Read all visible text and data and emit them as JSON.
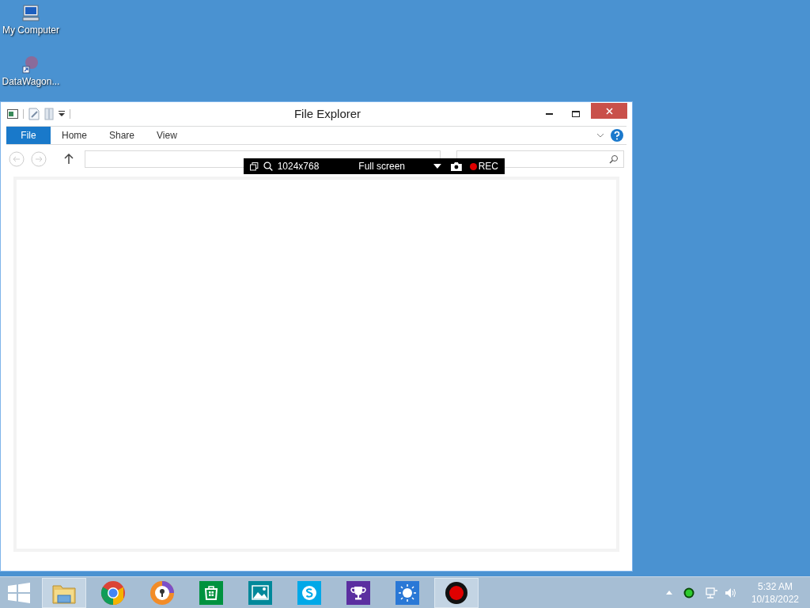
{
  "desktop_icons": [
    {
      "kind": "computer",
      "label": "My Computer"
    },
    {
      "kind": "shortcut",
      "label": "DataWagon..."
    }
  ],
  "window": {
    "title": "File Explorer",
    "ribbon_tabs": [
      {
        "label": "File",
        "selected": true
      },
      {
        "label": "Home",
        "selected": false
      },
      {
        "label": "Share",
        "selected": false
      },
      {
        "label": "View",
        "selected": false
      }
    ]
  },
  "recorder_bar": {
    "resolution": "1024x768",
    "mode": "Full screen",
    "record": "REC"
  },
  "taskbar": {
    "apps": [
      {
        "kind": "folder",
        "selected": true
      },
      {
        "kind": "chrome",
        "selected": false
      },
      {
        "kind": "secure-browser",
        "selected": false
      },
      {
        "kind": "store",
        "selected": false
      },
      {
        "kind": "photos",
        "selected": false
      },
      {
        "kind": "skype",
        "selected": false
      },
      {
        "kind": "trophy",
        "selected": false
      },
      {
        "kind": "weather",
        "selected": false
      },
      {
        "kind": "recorder",
        "selected": true
      }
    ],
    "clock": {
      "time": "5:32 AM",
      "date": "10/18/2022"
    }
  }
}
